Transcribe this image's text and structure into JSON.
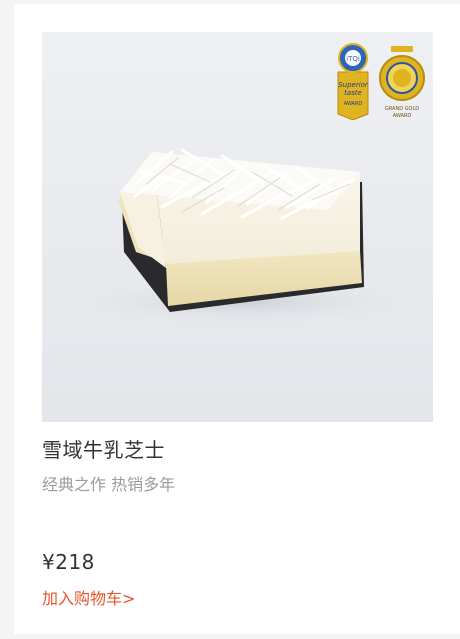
{
  "product": {
    "name": "雪域牛乳芝士",
    "tagline": "经典之作 热销多年",
    "price": "¥218",
    "add_to_cart": "加入购物车>",
    "badges": [
      {
        "icon": "superior-taste-award-badge-icon",
        "text": [
          "Superior",
          "taste",
          "AWARD"
        ]
      },
      {
        "icon": "grand-gold-award-medal-icon",
        "text": [
          "GRAND GOLD",
          "AWARD"
        ]
      }
    ]
  },
  "colors": {
    "accent": "#e4552b",
    "title": "#333333",
    "subtitle": "#9a9a9a",
    "badge_gold": "#e0b321"
  }
}
